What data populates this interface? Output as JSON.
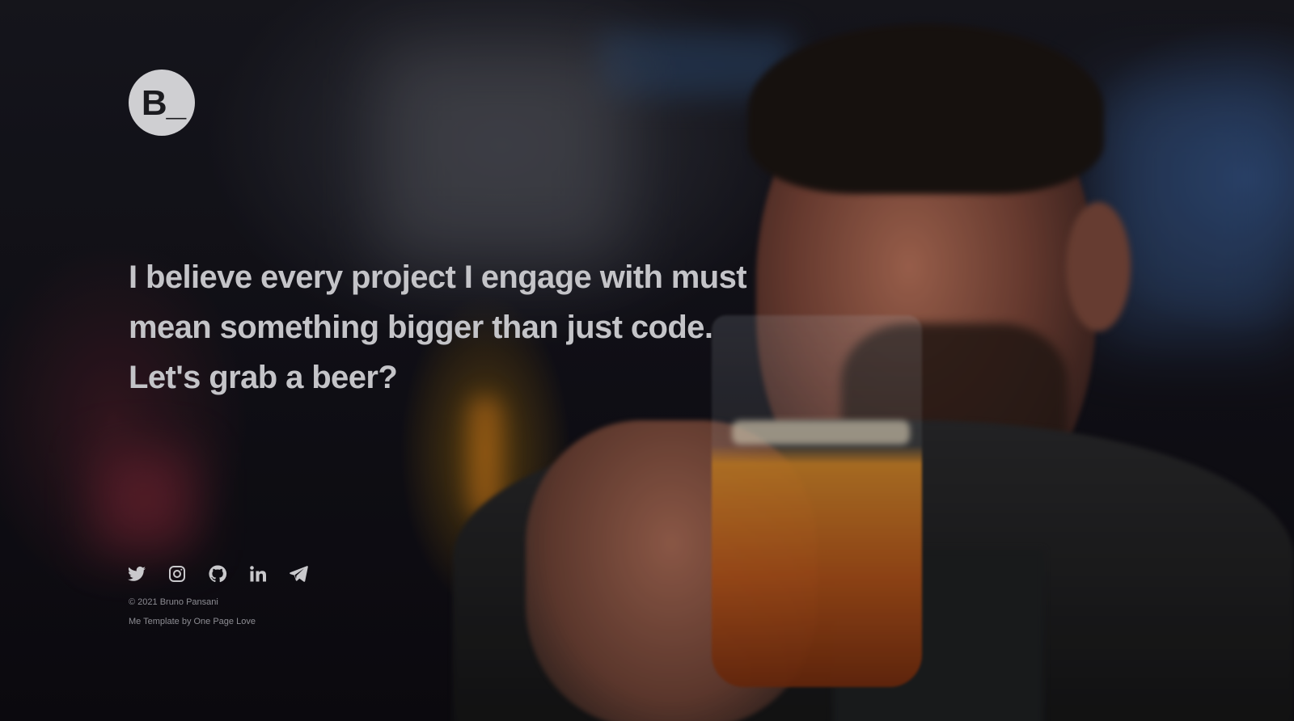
{
  "logo": {
    "text": "B_",
    "background": "#cfcfd2",
    "text_color": "#1b1b1f"
  },
  "headline": {
    "line1": "I believe every project I engage with must",
    "line2": "mean something bigger than just code.",
    "line3": "Let's grab a beer?",
    "color": "#c4c4c8"
  },
  "social": [
    {
      "icon": "twitter-icon"
    },
    {
      "icon": "instagram-icon"
    },
    {
      "icon": "github-icon"
    },
    {
      "icon": "linkedin-icon"
    },
    {
      "icon": "telegram-icon"
    }
  ],
  "footer": {
    "copyright": "© 2021  Bruno Pansani",
    "credit": "Me Template by One Page Love"
  }
}
